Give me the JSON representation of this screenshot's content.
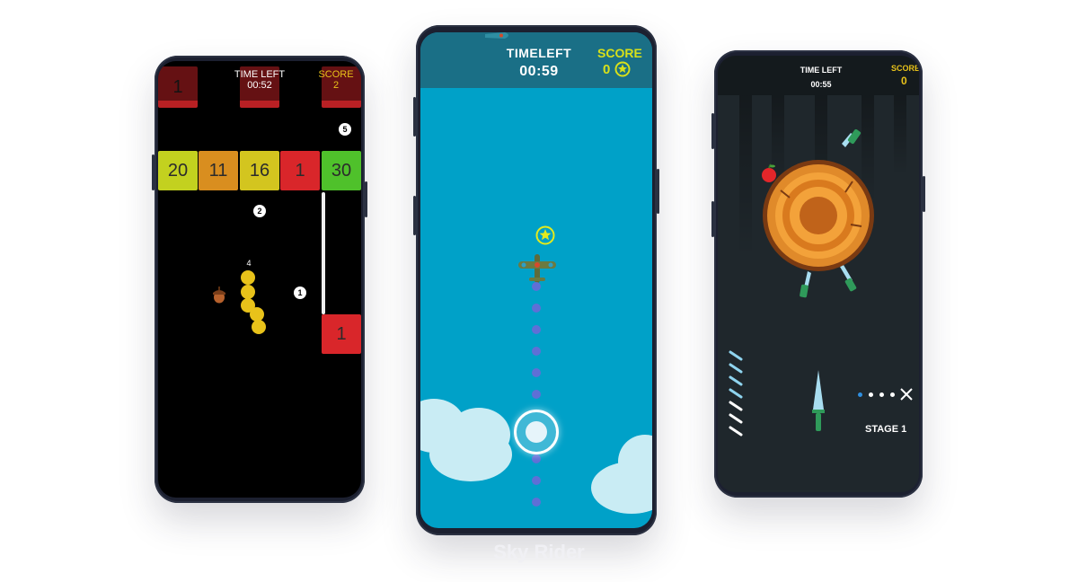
{
  "phone1": {
    "hud": {
      "time_label": "TIME LEFT",
      "time_value": "00:52",
      "score_label": "SCORE",
      "score_value": "2"
    },
    "top_blocks": [
      "1",
      "",
      ""
    ],
    "row_blocks": [
      {
        "value": "20",
        "color": "#c3d11f"
      },
      {
        "value": "11",
        "color": "#d98e1f"
      },
      {
        "value": "16",
        "color": "#d3c51f"
      },
      {
        "value": "1",
        "color": "#d9262a"
      },
      {
        "value": "30",
        "color": "#4fc12b"
      }
    ],
    "dots": [
      "5",
      "2",
      "1"
    ],
    "snake_length": "4",
    "bottom_block": {
      "value": "1",
      "color": "#d9262a"
    }
  },
  "phone2": {
    "hud": {
      "time_label": "TIMELEFT",
      "time_value": "00:59",
      "score_label": "SCORE",
      "score_value": "0"
    },
    "caption": "Sky Rider"
  },
  "phone3": {
    "hud": {
      "time_label": "TIME LEFT",
      "time_value": "00:55",
      "score_label": "SCORE",
      "score_value": "0"
    },
    "stage_label": "STAGE 1"
  },
  "colors": {
    "accent_yellow": "#e8c21a",
    "sky": "#00a1c8",
    "hud_teal": "#1a6f86",
    "trail": "#5f6fd6"
  }
}
